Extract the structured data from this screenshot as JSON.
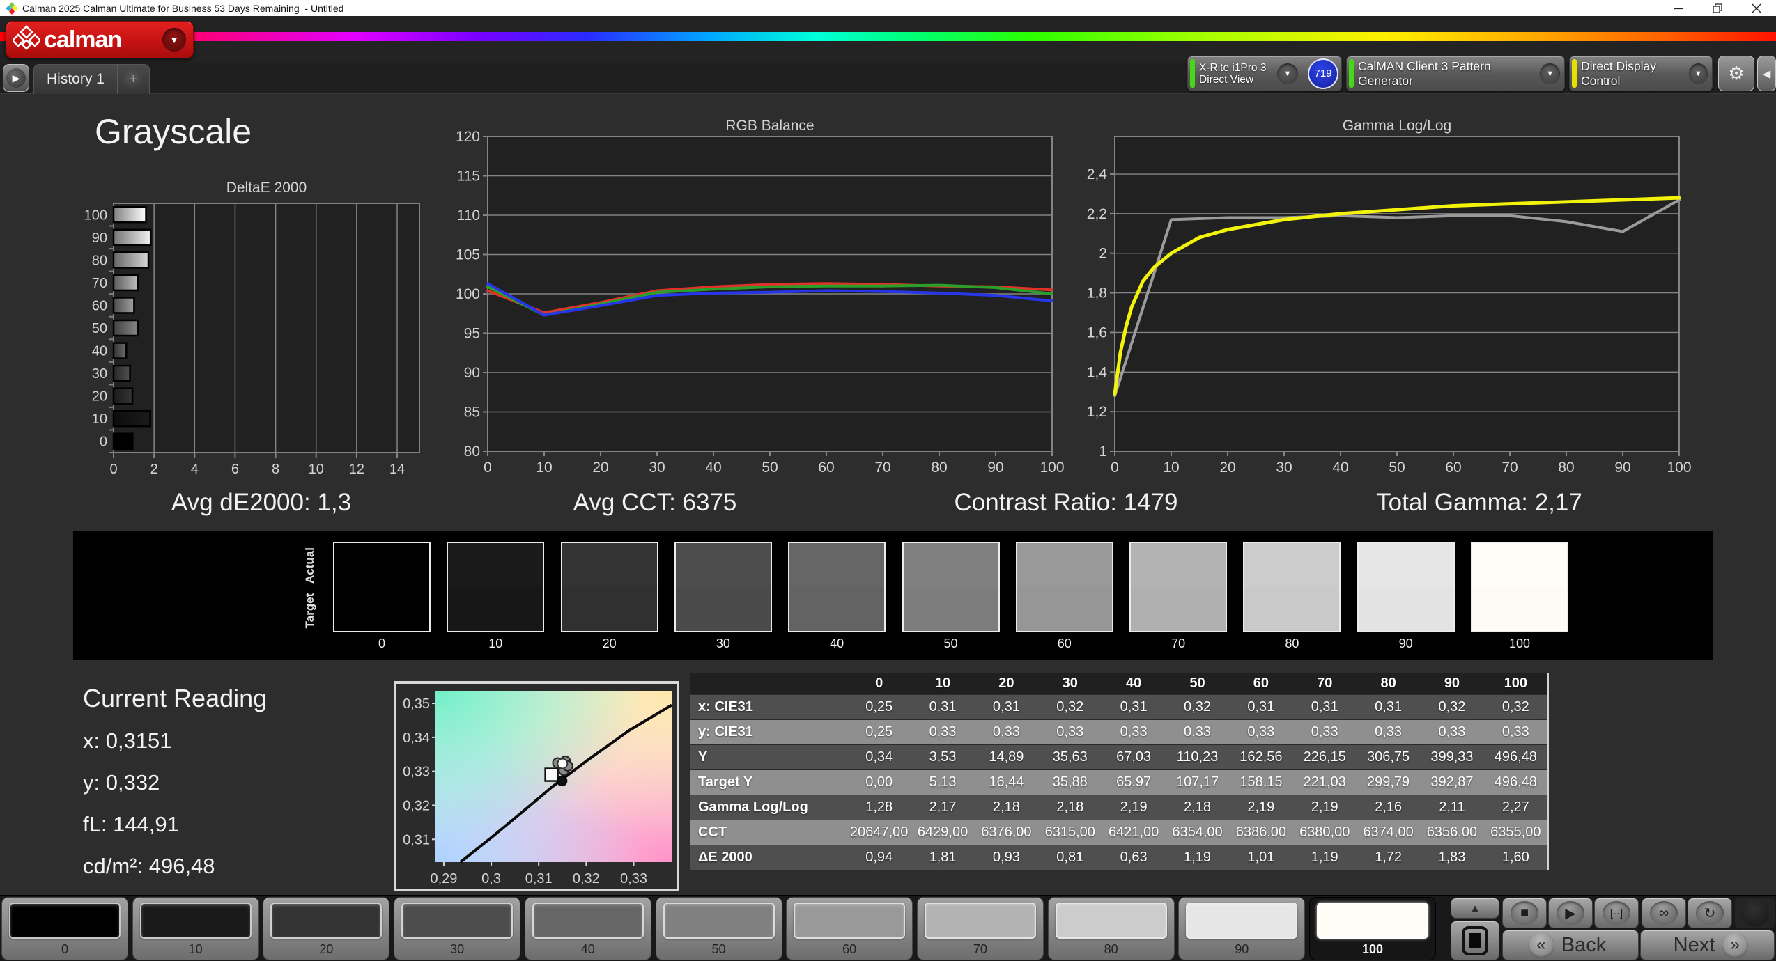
{
  "window": {
    "title": "Calman 2025 Calman Ultimate for Business 53 Days Remaining  - Untitled"
  },
  "header": {
    "logo_text": "calman"
  },
  "tabbar": {
    "history_tab": "History 1",
    "add_tab": "+"
  },
  "toolbar": {
    "meter_device": "X-Rite i1Pro 3",
    "meter_mode": "Direct View",
    "meter_badge": "719",
    "pattern_generator": "CalMAN Client 3 Pattern Generator",
    "display_control": "Direct Display Control"
  },
  "page": {
    "title": "Grayscale"
  },
  "stats": {
    "avg_de2000": "Avg dE2000: 1,3",
    "avg_cct": "Avg CCT: 6375",
    "contrast_ratio": "Contrast Ratio: 1479",
    "total_gamma": "Total Gamma: 2,17"
  },
  "swatch_strip": {
    "actual_label": "Actual",
    "target_label": "Target",
    "levels": [
      "0",
      "10",
      "20",
      "30",
      "40",
      "50",
      "60",
      "70",
      "80",
      "90",
      "100"
    ]
  },
  "current_reading": {
    "title": "Current Reading",
    "x": "x: 0,3151",
    "y": "y: 0,332",
    "fl": "fL: 144,91",
    "cdm2": "cd/m²: 496,48"
  },
  "table": {
    "columns": [
      "0",
      "10",
      "20",
      "30",
      "40",
      "50",
      "60",
      "70",
      "80",
      "90",
      "100"
    ],
    "rows": [
      {
        "label": "x: CIE31",
        "values": [
          "0,25",
          "0,31",
          "0,31",
          "0,32",
          "0,31",
          "0,32",
          "0,31",
          "0,31",
          "0,31",
          "0,32",
          "0,32"
        ]
      },
      {
        "label": "y: CIE31",
        "values": [
          "0,25",
          "0,33",
          "0,33",
          "0,33",
          "0,33",
          "0,33",
          "0,33",
          "0,33",
          "0,33",
          "0,33",
          "0,33"
        ]
      },
      {
        "label": "Y",
        "values": [
          "0,34",
          "3,53",
          "14,89",
          "35,63",
          "67,03",
          "110,23",
          "162,56",
          "226,15",
          "306,75",
          "399,33",
          "496,48"
        ]
      },
      {
        "label": "Target Y",
        "values": [
          "0,00",
          "5,13",
          "16,44",
          "35,88",
          "65,97",
          "107,17",
          "158,15",
          "221,03",
          "299,79",
          "392,87",
          "496,48"
        ]
      },
      {
        "label": "Gamma Log/Log",
        "values": [
          "1,28",
          "2,17",
          "2,18",
          "2,18",
          "2,19",
          "2,18",
          "2,19",
          "2,19",
          "2,16",
          "2,11",
          "2,27"
        ]
      },
      {
        "label": "CCT",
        "values": [
          "20647,00",
          "6429,00",
          "6376,00",
          "6315,00",
          "6421,00",
          "6354,00",
          "6386,00",
          "6380,00",
          "6374,00",
          "6356,00",
          "6355,00"
        ]
      },
      {
        "label": "ΔE 2000",
        "values": [
          "0,94",
          "1,81",
          "0,93",
          "0,81",
          "0,63",
          "1,19",
          "1,01",
          "1,19",
          "1,72",
          "1,83",
          "1,60"
        ]
      }
    ]
  },
  "bottom_bar": {
    "levels": [
      "0",
      "10",
      "20",
      "30",
      "40",
      "50",
      "60",
      "70",
      "80",
      "90",
      "100"
    ],
    "selected_level": "100",
    "back_label": "Back",
    "next_label": "Next"
  },
  "colors": {
    "meter_accent": "#45d815",
    "pattern_accent": "#45d815",
    "display_accent": "#e6e000",
    "logo_red": "#c61212",
    "badge_blue": "#2431d8"
  },
  "chart_data": [
    {
      "id": "deltae",
      "type": "bar",
      "orientation": "horizontal",
      "title": "DeltaE 2000",
      "categories": [
        0,
        10,
        20,
        30,
        40,
        50,
        60,
        70,
        80,
        90,
        100
      ],
      "values": [
        0.94,
        1.81,
        0.93,
        0.81,
        0.63,
        1.19,
        1.01,
        1.19,
        1.72,
        1.83,
        1.6
      ],
      "xlim": [
        0,
        15.1
      ],
      "x_ticks": [
        0,
        2,
        4,
        6,
        8,
        10,
        12,
        14
      ],
      "grid": true,
      "note": "bars shaded with the grayscale tone of each level"
    },
    {
      "id": "rgb_balance",
      "type": "line",
      "title": "RGB Balance",
      "x": [
        0,
        10,
        20,
        30,
        40,
        50,
        60,
        70,
        80,
        90,
        100
      ],
      "ylim": [
        80,
        120
      ],
      "y_ticks": [
        80,
        85,
        90,
        95,
        100,
        105,
        110,
        115,
        120
      ],
      "series": [
        {
          "name": "Red",
          "color": "#e03228",
          "values": [
            100.4,
            97.6,
            98.9,
            100.4,
            100.9,
            101.2,
            101.3,
            101.2,
            101.0,
            100.9,
            100.5
          ]
        },
        {
          "name": "Green",
          "color": "#2aa02a",
          "values": [
            100.9,
            97.3,
            98.7,
            100.2,
            100.6,
            100.9,
            101.0,
            101.0,
            101.1,
            100.8,
            100.0
          ]
        },
        {
          "name": "Blue",
          "color": "#2636e8",
          "values": [
            101.3,
            97.3,
            98.5,
            99.8,
            100.1,
            100.2,
            100.4,
            100.3,
            100.1,
            99.8,
            99.1
          ]
        }
      ]
    },
    {
      "id": "gamma_loglog",
      "type": "line",
      "title": "Gamma Log/Log",
      "ylim": [
        1.0,
        2.59
      ],
      "y_ticks": [
        1,
        1.2,
        1.4,
        1.6,
        1.8,
        2,
        2.2,
        2.4
      ],
      "y_tick_labels": [
        "1",
        "1,2",
        "1,4",
        "1,6",
        "1,8",
        "2",
        "2,2",
        "2,4"
      ],
      "x_ticks": [
        0,
        10,
        20,
        30,
        40,
        50,
        60,
        70,
        80,
        90,
        100
      ],
      "series": [
        {
          "name": "Measured",
          "color": "#9b9b9b",
          "x": [
            0,
            10,
            20,
            30,
            40,
            50,
            60,
            70,
            80,
            90,
            100
          ],
          "values": [
            1.28,
            2.17,
            2.18,
            2.18,
            2.19,
            2.18,
            2.19,
            2.19,
            2.16,
            2.11,
            2.27
          ]
        },
        {
          "name": "Target",
          "color": "#f2f20a",
          "x": [
            0,
            1,
            2,
            3,
            5,
            7,
            10,
            15,
            20,
            30,
            40,
            50,
            60,
            70,
            80,
            90,
            100
          ],
          "values": [
            1.29,
            1.5,
            1.63,
            1.73,
            1.86,
            1.93,
            2.0,
            2.08,
            2.12,
            2.17,
            2.2,
            2.22,
            2.24,
            2.25,
            2.26,
            2.27,
            2.28
          ]
        }
      ]
    },
    {
      "id": "cie_xy",
      "type": "scatter",
      "xlim": [
        0.2881,
        0.338
      ],
      "ylim": [
        0.3033,
        0.3537
      ],
      "x_ticks": [
        0.29,
        0.3,
        0.31,
        0.32,
        0.33
      ],
      "x_tick_labels": [
        "0,29",
        "0,3",
        "0,31",
        "0,32",
        "0,33"
      ],
      "y_ticks": [
        0.31,
        0.32,
        0.33,
        0.34,
        0.35
      ],
      "y_tick_labels": [
        "0,31",
        "0,32",
        "0,33",
        "0,34",
        "0,35"
      ],
      "locus": [
        [
          0.2935,
          0.3033
        ],
        [
          0.3,
          0.3105
        ],
        [
          0.3065,
          0.318
        ],
        [
          0.3127,
          0.3253
        ],
        [
          0.32,
          0.333
        ],
        [
          0.329,
          0.342
        ],
        [
          0.338,
          0.3495
        ]
      ],
      "target_square": [
        0.3127,
        0.329
      ],
      "points_gray": [
        [
          0.314,
          0.3325
        ],
        [
          0.3156,
          0.333
        ],
        [
          0.3153,
          0.3303
        ],
        [
          0.3161,
          0.3316
        ]
      ],
      "point_black": [
        0.3149,
        0.3272
      ],
      "point_white": [
        0.315,
        0.3323
      ]
    }
  ]
}
